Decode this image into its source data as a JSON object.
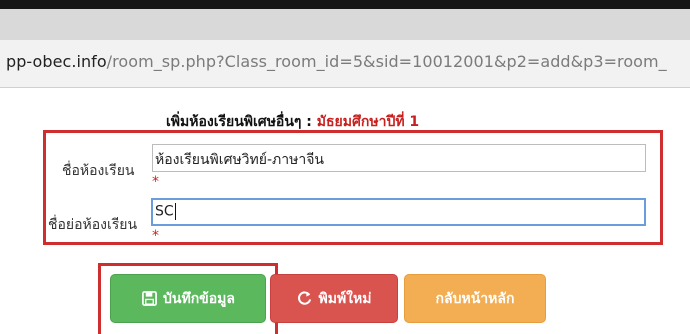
{
  "browser": {
    "url_domain": "pp-obec.info",
    "url_path": "/room_sp.php?Class_room_id=5&sid=10012001&p2=add&p3=room_"
  },
  "page": {
    "heading_main": "เพิ่มห้องเรียนพิเศษอื่นๆ : ",
    "heading_accent": "มัธยมศึกษาปีที่ 1"
  },
  "form": {
    "room_name_label": "ชื่อห้องเรียน",
    "room_name_value": "ห้องเรียนพิเศษวิทย์-ภาษาจีน",
    "room_abbr_label": "ชื่อย่อห้องเรียน",
    "room_abbr_value": "SC",
    "required_mark": "*"
  },
  "buttons": {
    "save_label": "บันทึกข้อมูล",
    "reset_label": "พิมพ์ใหม่",
    "home_label": "กลับหน้าหลัก"
  },
  "colors": {
    "save": "#5bb85d",
    "reset": "#d9534f",
    "home": "#f3ad52",
    "highlight": "#cf2e2e",
    "heading_accent": "#c8201f"
  }
}
